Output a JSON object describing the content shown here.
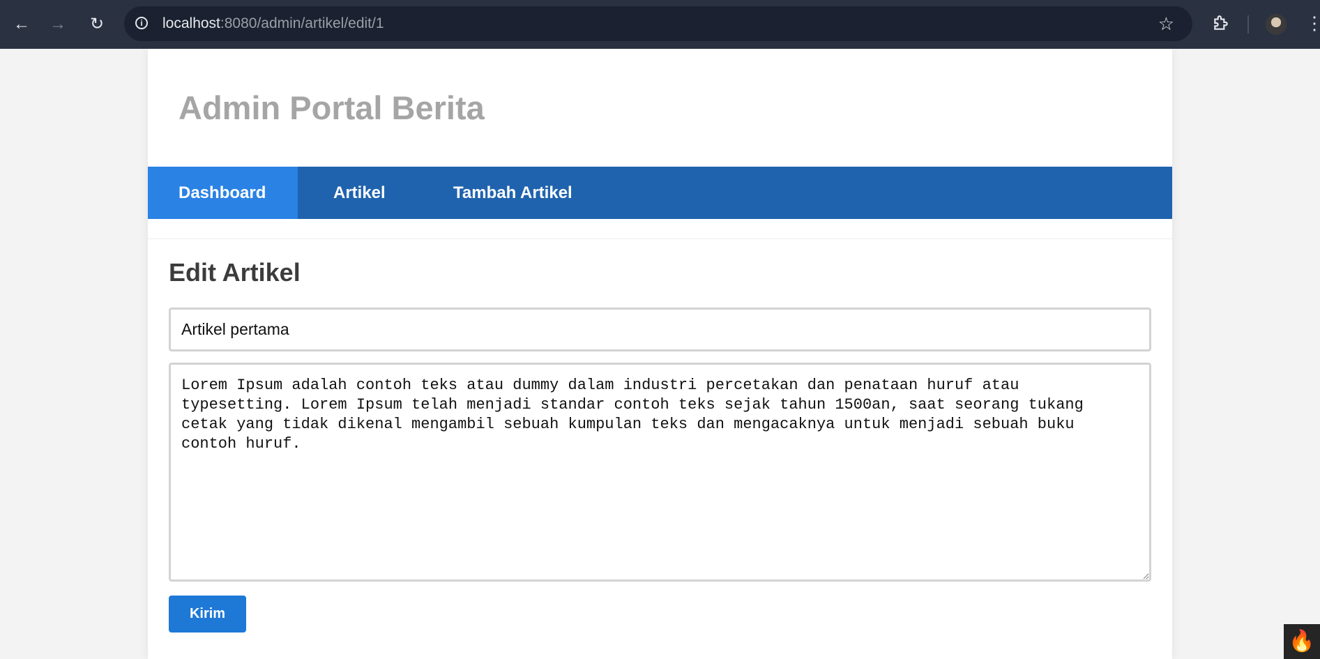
{
  "browser": {
    "url_host": "localhost",
    "url_rest": ":8080/admin/artikel/edit/1"
  },
  "site": {
    "title": "Admin Portal Berita"
  },
  "nav": {
    "items": [
      {
        "label": "Dashboard",
        "active": true
      },
      {
        "label": "Artikel",
        "active": false
      },
      {
        "label": "Tambah Artikel",
        "active": false
      }
    ]
  },
  "form": {
    "heading": "Edit Artikel",
    "title_value": "Artikel pertama",
    "body_value": "Lorem Ipsum adalah contoh teks atau dummy dalam industri percetakan dan penataan huruf atau typesetting. Lorem Ipsum telah menjadi standar contoh teks sejak tahun 1500an, saat seorang tukang cetak yang tidak dikenal mengambil sebuah kumpulan teks dan mengacaknya untuk menjadi sebuah buku contoh huruf.",
    "submit_label": "Kirim"
  },
  "icons": {
    "back": "back-arrow-icon",
    "forward": "forward-arrow-icon",
    "reload": "reload-icon",
    "site_info": "info-icon",
    "bookmark": "star-icon",
    "extensions": "puzzle-icon",
    "profile": "avatar",
    "menu": "kebab-menu-icon",
    "debug": "flame-icon"
  },
  "colors": {
    "navbar": "#1f63ae",
    "nav_active": "#2a82e4",
    "button": "#1e78d6",
    "title": "#a5a5a5"
  }
}
